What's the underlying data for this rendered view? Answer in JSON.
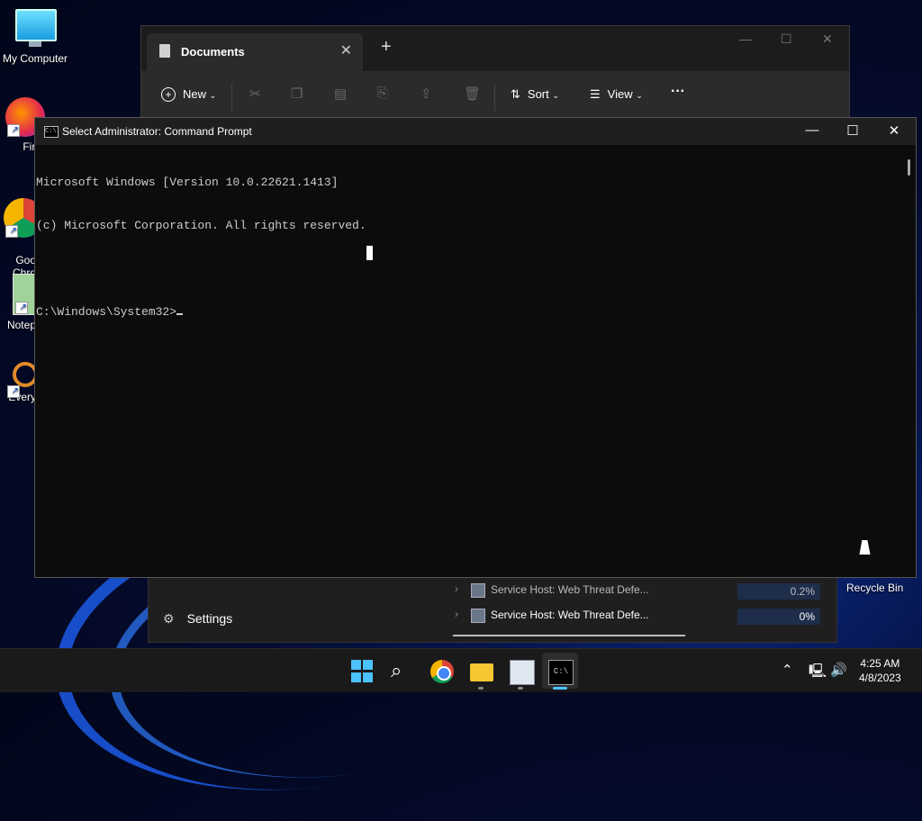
{
  "desktop": {
    "icons": [
      {
        "label": "My Computer"
      },
      {
        "label": "Fire"
      },
      {
        "label": "Goo\nChro"
      },
      {
        "label": "Notep"
      },
      {
        "label": "Every"
      }
    ],
    "recycle_bin": "Recycle Bin"
  },
  "explorer": {
    "tab_title": "Documents",
    "new_tab_glyph": "+",
    "toolbar": {
      "new_label": "New",
      "sort_label": "Sort",
      "view_label": "View",
      "more_label": "···"
    }
  },
  "task_manager": {
    "settings_label": "Settings",
    "rows": [
      {
        "name": "Service Host: Web Threat Defe...",
        "cpu": "0.2%"
      },
      {
        "name": "Service Host: Web Threat Defe...",
        "cpu": "0%"
      }
    ]
  },
  "cmd": {
    "title": "Select Administrator: Command Prompt",
    "icon_text": "C:\\",
    "lines": [
      "Microsoft Windows [Version 10.0.22621.1413]",
      "(c) Microsoft Corporation. All rights reserved.",
      "",
      "C:\\Windows\\System32>"
    ]
  },
  "taskbar": {
    "time": "4:25 AM",
    "date": "4/8/2023"
  },
  "colors": {
    "accent": "#4cc2ff",
    "console_text": "#cccccc",
    "console_bg": "#0c0c0c"
  }
}
